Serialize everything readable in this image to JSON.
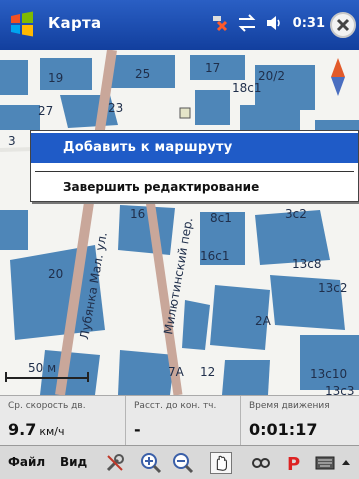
{
  "window": {
    "title": "Карта",
    "time": "0:31"
  },
  "map": {
    "building_numbers": [
      "19",
      "25",
      "17",
      "20/2",
      "27",
      "23",
      "18с1",
      "16",
      "8с1",
      "3с2",
      "20",
      "16с1",
      "13с8",
      "13с2",
      "2А",
      "7А",
      "12",
      "13с10",
      "13с3",
      "3"
    ],
    "streets": [
      "Лубянка Мал. ул.",
      "Милютинский пер."
    ],
    "scale_label": "50 м"
  },
  "context_menu": {
    "items": [
      "Добавить к маршруту",
      "Завершить редактирование"
    ],
    "selected_index": 0
  },
  "info_panel": {
    "avg_speed": {
      "label": "Ср. скорость дв.",
      "value": "9.7",
      "unit": "км/ч"
    },
    "distance": {
      "label": "Расст. до кон. тч.",
      "value": "-"
    },
    "travel_time": {
      "label": "Время движения",
      "value": "0:01:17"
    }
  },
  "toolbar": {
    "menu_file": "Файл",
    "menu_view": "Вид"
  },
  "colors": {
    "titlebar": "#1c4fb3",
    "building": "#4e86b8",
    "menu_highlight": "#1f5bc7"
  },
  "icons": [
    "windows-logo-icon",
    "gps-disabled-icon",
    "connectivity-icon",
    "volume-icon",
    "close-icon",
    "compass-icon",
    "tools-icon",
    "zoom-in-icon",
    "zoom-out-icon",
    "pan-hand-icon",
    "route-icon",
    "parking-icon",
    "keyboard-icon"
  ]
}
